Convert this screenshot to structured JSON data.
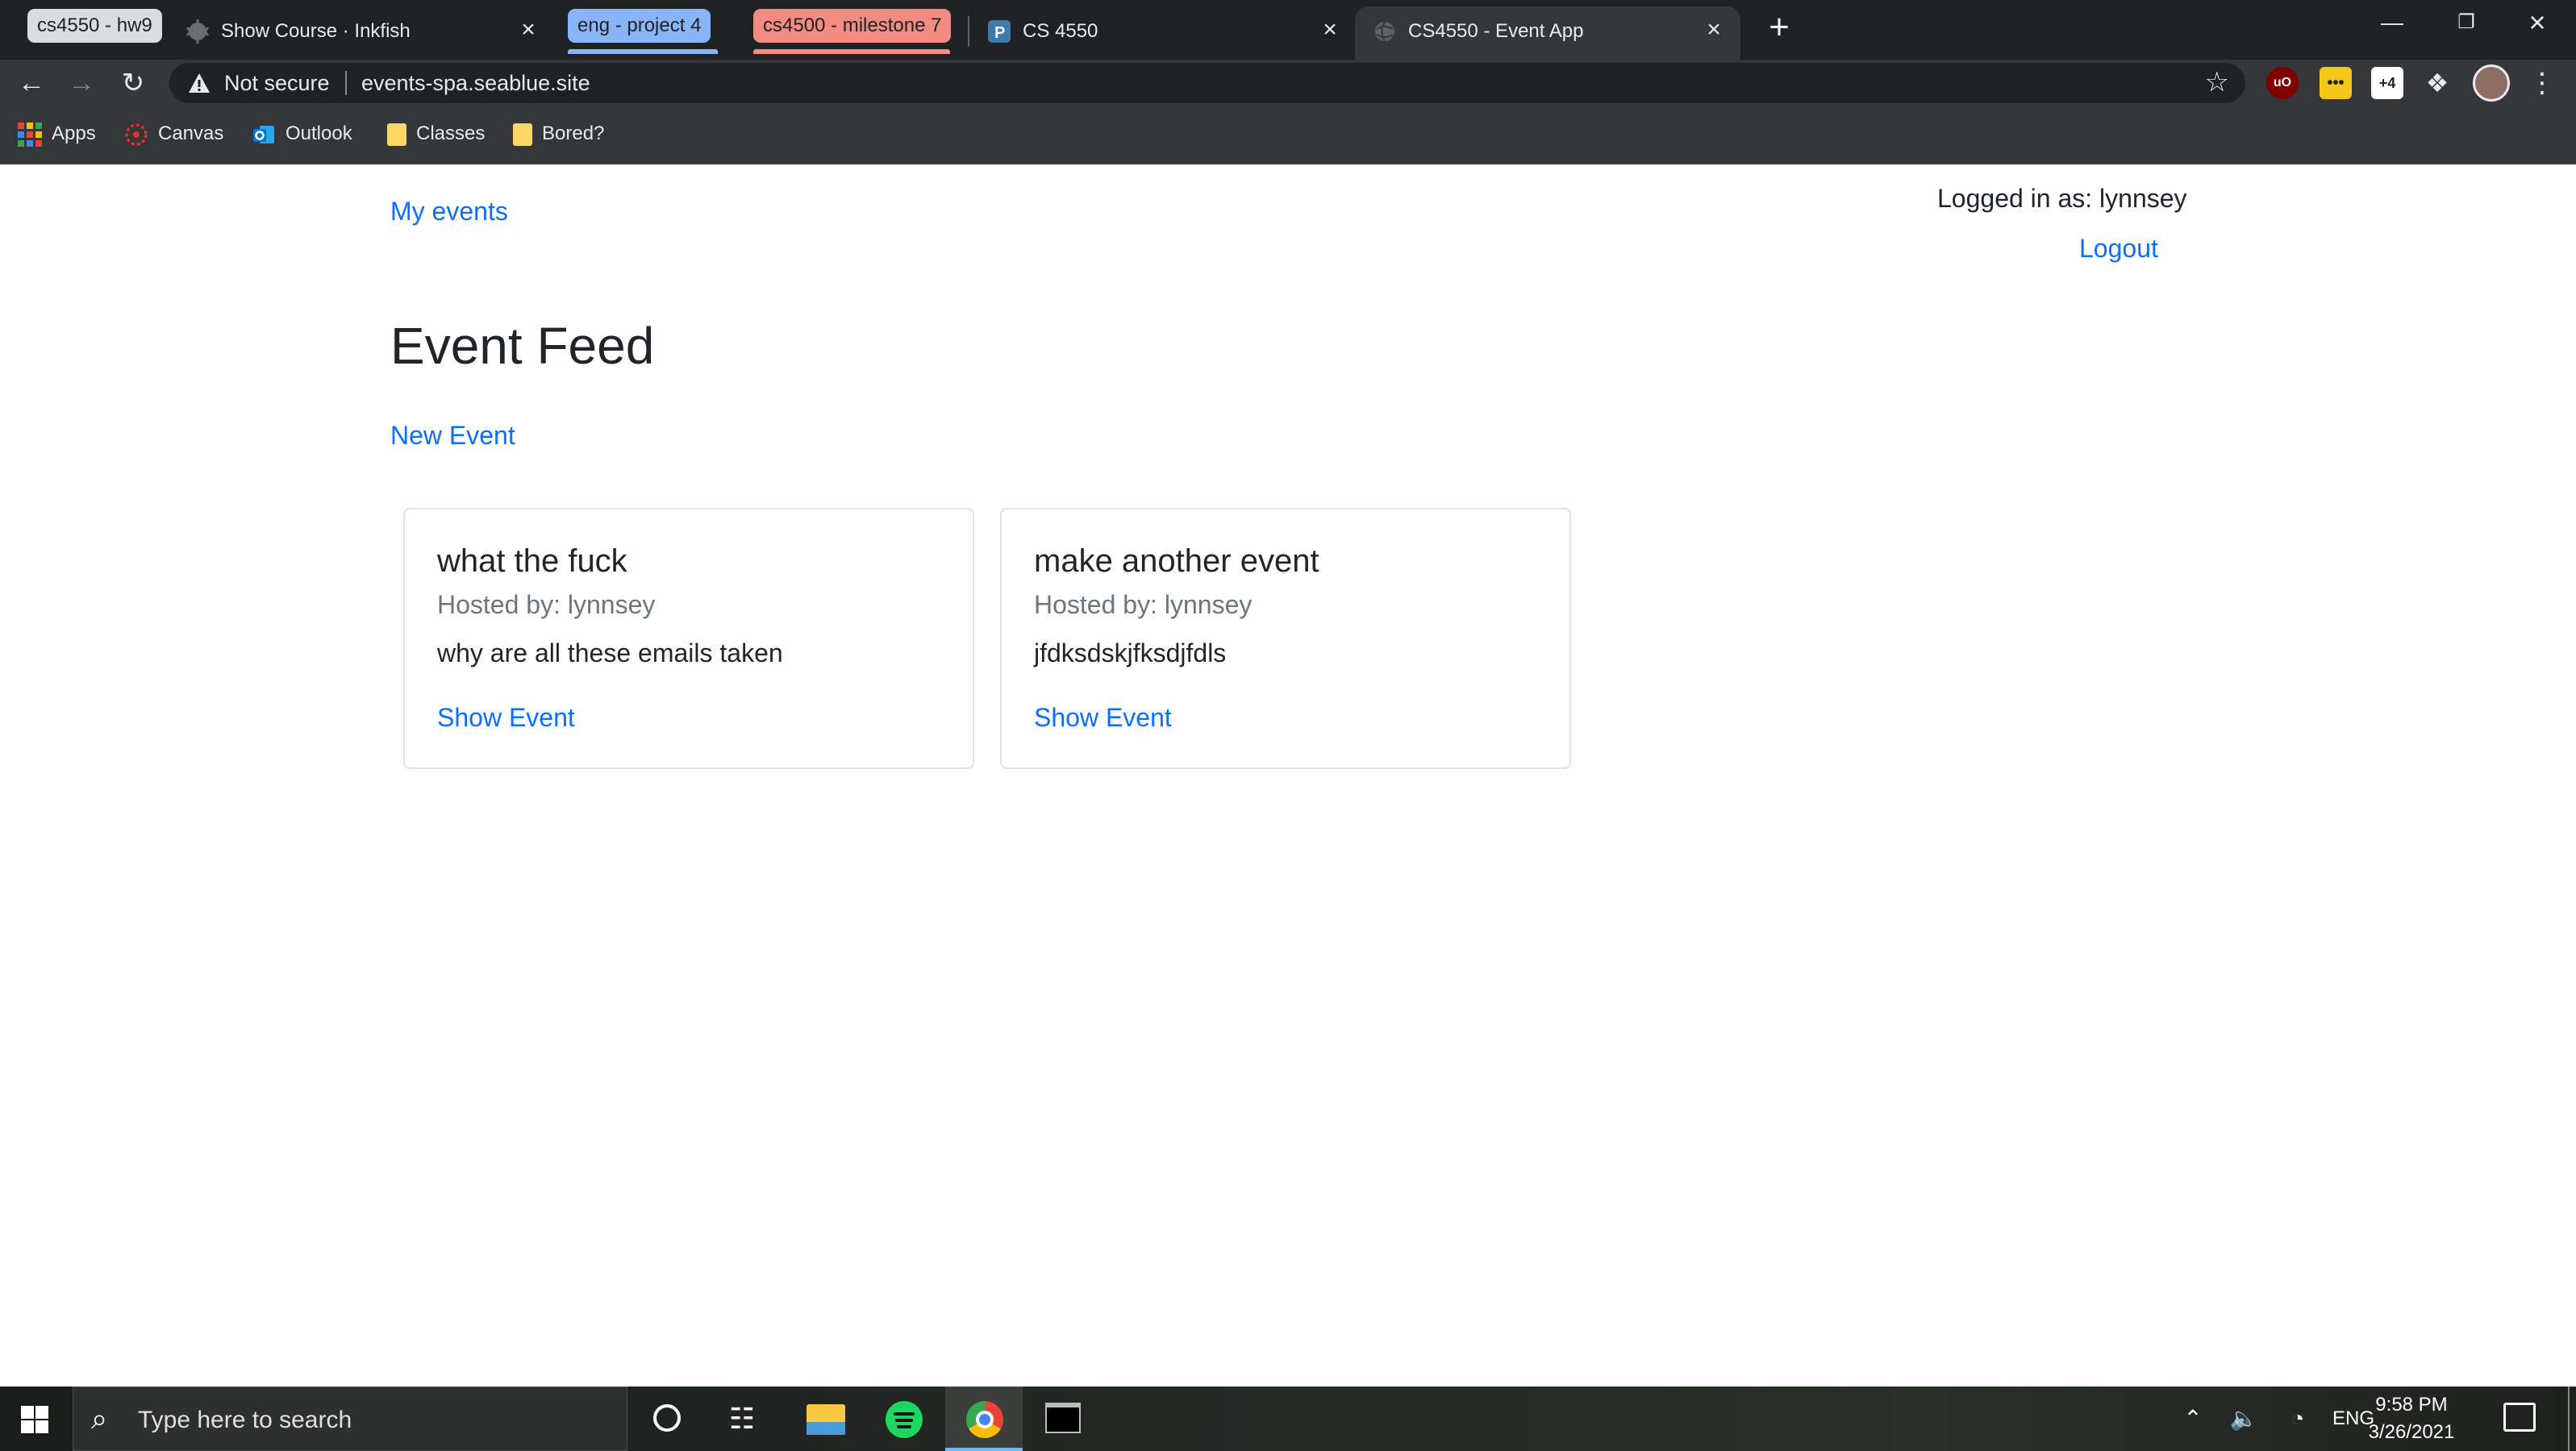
{
  "browser": {
    "tab_groups": [
      {
        "label": "cs4550 - hw9",
        "color": "#dadce0"
      },
      {
        "label": "eng - project 4",
        "color": "#8ab4f8"
      },
      {
        "label": "cs4500 - milestone 7",
        "color": "#f28b82"
      }
    ],
    "tabs": [
      {
        "title": "Show Course · Inkfish",
        "icon": "inkfish-favicon"
      },
      {
        "title": "CS 4550",
        "icon": "piazza-favicon"
      },
      {
        "title": "CS4550 - Event App",
        "icon": "globe-favicon",
        "active": true
      }
    ],
    "toolbar": {
      "security_label": "Not secure",
      "url": "events-spa.seablue.site"
    },
    "bookmarks": [
      {
        "label": "Apps",
        "icon": "apps-grid-icon"
      },
      {
        "label": "Canvas",
        "icon": "canvas-icon"
      },
      {
        "label": "Outlook",
        "icon": "outlook-icon"
      },
      {
        "label": "Classes",
        "icon": "folder-icon"
      },
      {
        "label": "Bored?",
        "icon": "folder-icon"
      }
    ],
    "extensions": {
      "ublock": "uO",
      "yellow_ext": "•••",
      "white_ext": "+4"
    }
  },
  "page": {
    "nav_my_events": "My events",
    "login_status": "Logged in as: lynnsey",
    "logout": "Logout",
    "title": "Event Feed",
    "new_event": "New Event",
    "events": [
      {
        "name": "what the fuck",
        "host": "Hosted by: lynnsey",
        "description": "why are all these emails taken",
        "link": "Show Event"
      },
      {
        "name": "make another event",
        "host": "Hosted by: lynnsey",
        "description": "jfdksdskjfksdjfdls",
        "link": "Show Event"
      }
    ]
  },
  "taskbar": {
    "search_placeholder": "Type here to search",
    "language": "ENG",
    "time": "9:58 PM",
    "date": "3/26/2021"
  }
}
